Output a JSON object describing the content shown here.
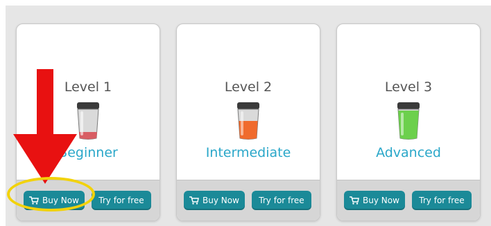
{
  "cards": [
    {
      "title": "Level 1",
      "name": "Beginner",
      "buy_label": "Buy Now",
      "try_label": "Try for free",
      "fill_color": "#d85e64",
      "fill_level": 0.15
    },
    {
      "title": "Level 2",
      "name": "Intermediate",
      "buy_label": "Buy Now",
      "try_label": "Try for free",
      "fill_color": "#f06b2d",
      "fill_level": 0.55
    },
    {
      "title": "Level 3",
      "name": "Advanced",
      "buy_label": "Buy Now",
      "try_label": "Try for free",
      "fill_color": "#6cd04c",
      "fill_level": 0.95
    }
  ],
  "colors": {
    "accent_text": "#2aa7c9",
    "button_bg": "#1b8a98",
    "arrow": "#e81111",
    "highlight": "#f2d20a"
  },
  "icons": {
    "cart": "shopping-cart-icon",
    "jar": "jar-icon",
    "arrow": "down-arrow-icon"
  }
}
